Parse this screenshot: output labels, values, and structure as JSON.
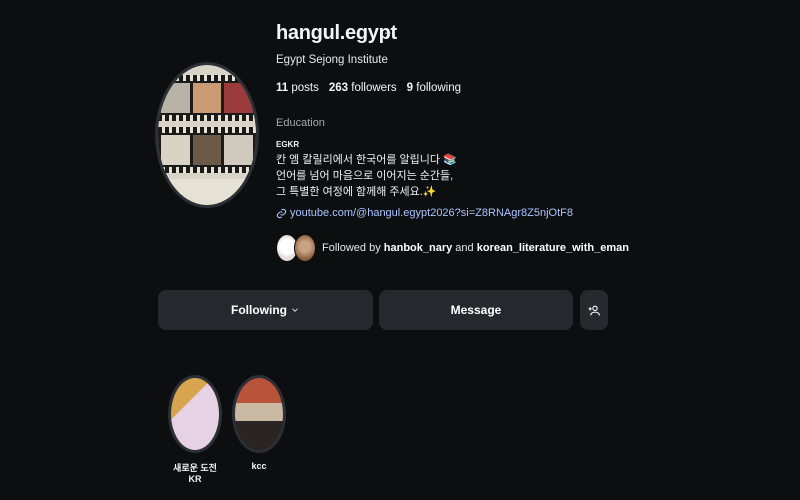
{
  "profile": {
    "username": "hangul.egypt",
    "more_glyph": "···",
    "full_name": "Egypt Sejong Institute",
    "stats": {
      "posts_count": "11",
      "posts_label": "posts",
      "followers_count": "263",
      "followers_label": "followers",
      "following_count": "9",
      "following_label": "following"
    },
    "category": "Education",
    "bio_title": "EGKR",
    "bio_lines": [
      "칸 엠 칼릴리에서 한국어를 알립니다 📚",
      "언어를 넘어 마음으로 이어지는 순간들,",
      "그 특별한 여정에 함께해 주세요.✨"
    ],
    "link": "youtube.com/@hangul.egypt2026?si=Z8RNAgr8Z5njOtF8",
    "followed_by": {
      "prefix": "Followed by",
      "user1": "hanbok_nary",
      "joiner": "and",
      "user2": "korean_literature_with_eman"
    }
  },
  "actions": {
    "following_label": "Following",
    "message_label": "Message"
  },
  "highlights": [
    {
      "label": "새로운 도전KR"
    },
    {
      "label": "kcc"
    }
  ],
  "colors": {
    "background": "#0d0e10",
    "button": "#25292e",
    "link": "#a9c6ff"
  }
}
